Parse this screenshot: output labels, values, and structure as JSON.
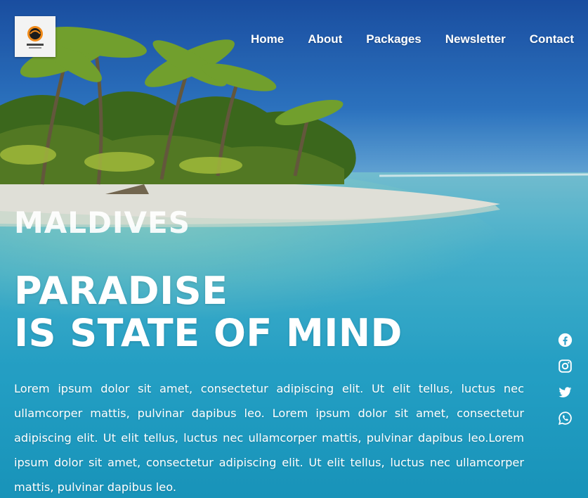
{
  "nav": {
    "items": [
      {
        "label": "Home"
      },
      {
        "label": "About"
      },
      {
        "label": "Packages"
      },
      {
        "label": "Newsletter"
      },
      {
        "label": "Contact"
      }
    ]
  },
  "logo": {
    "text": "Where To Go",
    "icon": "globe-logo-icon"
  },
  "hero": {
    "kicker": "MALDIVES",
    "title_line1": "PARADISE",
    "title_line2": "IS STATE OF MIND",
    "body": "Lorem ipsum dolor sit amet, consectetur adipiscing elit. Ut elit tellus, luctus nec ullamcorper mattis, pulvinar dapibus leo. Lorem ipsum dolor sit amet, consectetur adipiscing elit. Ut elit tellus, luctus nec ullamcorper mattis, pulvinar dapibus leo.Lorem ipsum dolor sit amet, consectetur adipiscing elit. Ut elit tellus, luctus nec ullamcorper mattis, pulvinar dapibus leo."
  },
  "social": [
    {
      "icon": "facebook-icon"
    },
    {
      "icon": "instagram-icon"
    },
    {
      "icon": "twitter-icon"
    },
    {
      "icon": "whatsapp-icon"
    }
  ],
  "colors": {
    "sky": "#1f63b8",
    "water": "#22a9cf",
    "sand": "#f1ede2",
    "palm": "#5f8f1e",
    "text": "#ffffff"
  }
}
